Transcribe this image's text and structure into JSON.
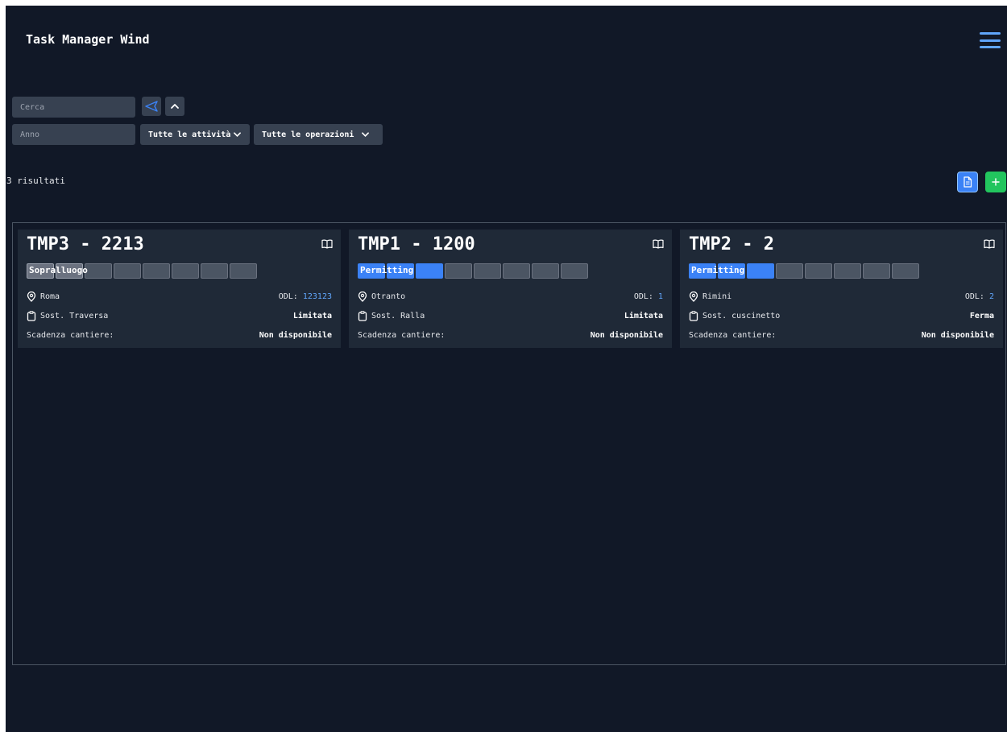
{
  "header": {
    "title": "Task Manager Wind"
  },
  "filters": {
    "search_placeholder": "Cerca",
    "year_placeholder": "Anno",
    "activities_label": "Tutte le attività",
    "operations_label": "Tutte le operazioni"
  },
  "results_text": "3 risultati",
  "colors": {
    "background": "#111827",
    "card": "#1f2937",
    "accent": "#3b82f6",
    "add": "#22c55e"
  },
  "cards": [
    {
      "title": "TMP3 - 2213",
      "stage_label": "Sopralluogo",
      "location": "Roma",
      "odl_label": "ODL:",
      "odl_value": "123123",
      "task": "Sost. Traversa",
      "status": "Limitata",
      "deadline_label": "Scadenza cantiere:",
      "deadline_value": "Non disponibile"
    },
    {
      "title": "TMP1 - 1200",
      "stage_label": "Permitting",
      "location": "Otranto",
      "odl_label": "ODL:",
      "odl_value": "1",
      "task": "Sost. Ralla",
      "status": "Limitata",
      "deadline_label": "Scadenza cantiere:",
      "deadline_value": "Non disponibile"
    },
    {
      "title": "TMP2 - 2",
      "stage_label": "Permitting",
      "location": "Rimini",
      "odl_label": "ODL:",
      "odl_value": "2",
      "task": "Sost. cuscinetto",
      "status": "Ferma",
      "deadline_label": "Scadenza cantiere:",
      "deadline_value": "Non disponibile"
    }
  ]
}
